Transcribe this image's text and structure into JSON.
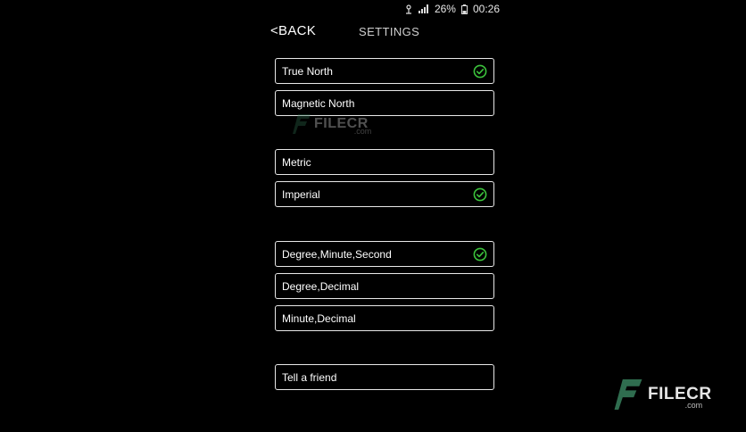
{
  "status_bar": {
    "battery_percent": "26%",
    "time": "00:26",
    "icons": [
      "alarm-icon",
      "signal-icon",
      "battery-icon"
    ]
  },
  "header": {
    "back_label": "<BACK",
    "title": "SETTINGS"
  },
  "groups": {
    "north": [
      {
        "label": "True North",
        "checked": true
      },
      {
        "label": "Magnetic North",
        "checked": false
      }
    ],
    "units": [
      {
        "label": "Metric",
        "checked": false
      },
      {
        "label": "Imperial",
        "checked": true
      }
    ],
    "coordinates": [
      {
        "label": "Degree,Minute,Second",
        "checked": true
      },
      {
        "label": "Degree,Decimal",
        "checked": false
      },
      {
        "label": "Minute,Decimal",
        "checked": false
      }
    ],
    "share": [
      {
        "label": "Tell a friend",
        "checked": false
      }
    ]
  },
  "watermark": {
    "brand": "FILECR",
    "suffix": ".com"
  },
  "colors": {
    "background": "#000000",
    "border": "#e8e8e8",
    "check": "#3cc33c"
  }
}
